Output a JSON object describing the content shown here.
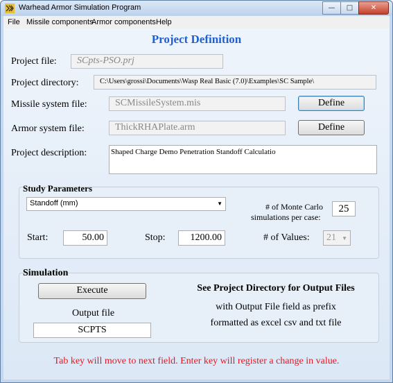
{
  "window": {
    "title": "Warhead Armor Simulation Program"
  },
  "menu": {
    "file": "File",
    "missile": "Missile components",
    "armor": "Armor components",
    "help": "Help"
  },
  "heading": "Project Definition",
  "project_file": {
    "label": "Project file:",
    "value": "SCpts-PSO.prj"
  },
  "project_directory": {
    "label": "Project directory:",
    "value": "C:\\Users\\grossi\\Documents\\Wasp Real Basic (7.0)\\Examples\\SC Sample\\"
  },
  "missile_file": {
    "label": "Missile system file:",
    "value": "SCMissileSystem.mis",
    "button": "Define"
  },
  "armor_file": {
    "label": "Armor system file:",
    "value": "ThickRHAPlate.arm",
    "button": "Define"
  },
  "project_description": {
    "label": "Project description:",
    "value": "Shaped Charge Demo Penetration Standoff Calculatio"
  },
  "study": {
    "title": "Study Parameters",
    "parameter": "Standoff (mm)",
    "mc_label_1": "# of Monte Carlo",
    "mc_label_2": "simulations per case:",
    "mc_value": "25",
    "start_label": "Start:",
    "start_value": "50.00",
    "stop_label": "Stop:",
    "stop_value": "1200.00",
    "nvalues_label": "# of Values:",
    "nvalues_value": "21"
  },
  "simulation": {
    "title": "Simulation",
    "execute": "Execute",
    "output_label": "Output file",
    "output_value": "SCPTS",
    "info_title": "See Project Directory for Output Files",
    "info_line1": "with Output File field as prefix",
    "info_line2": "formatted as excel csv and txt file"
  },
  "footer": "Tab key will move to next field.  Enter key will register a change in value."
}
